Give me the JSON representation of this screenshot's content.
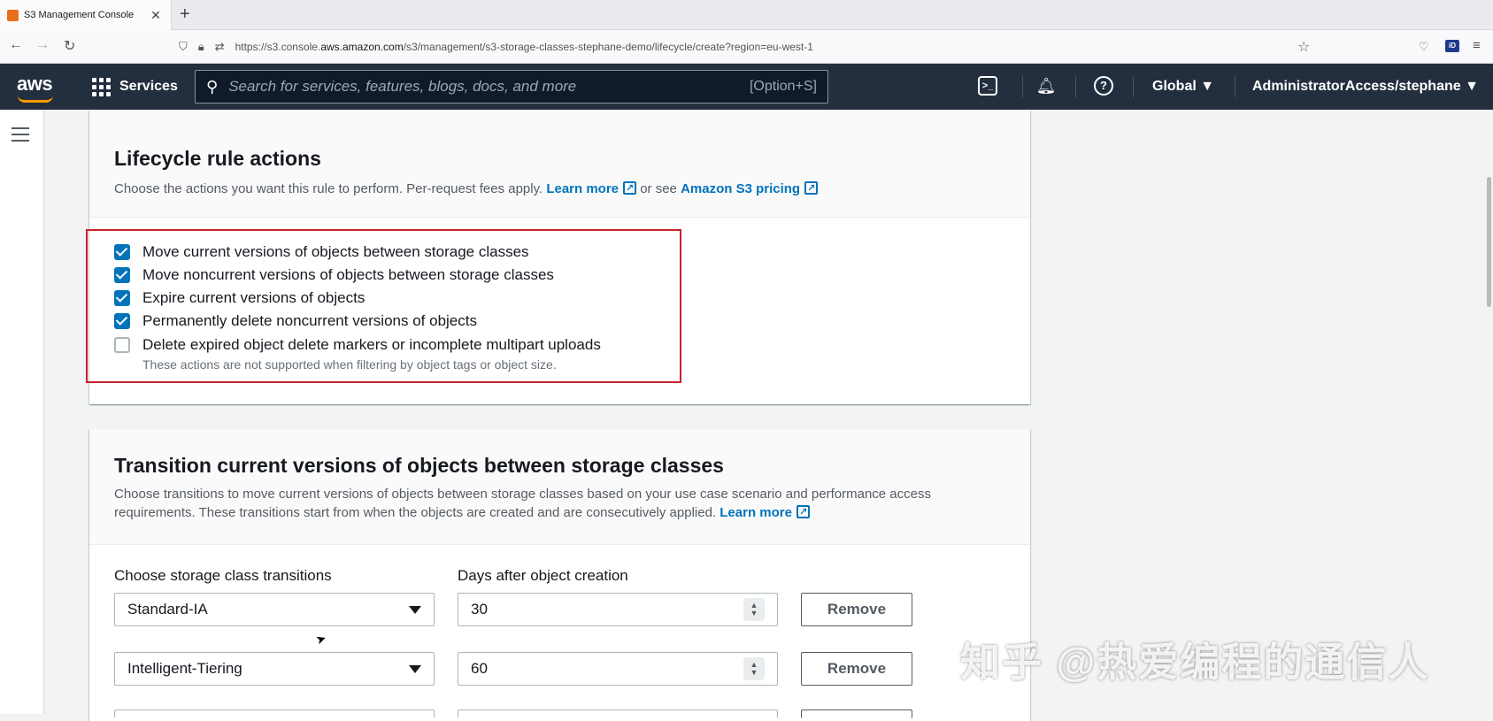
{
  "browser": {
    "tab_title": "S3 Management Console",
    "tab_close": "✕",
    "new_tab": "+",
    "url_prefix": "https://s3.console.",
    "url_host": "aws.amazon.com",
    "url_path": "/s3/management/s3-storage-classes-stephane-demo/lifecycle/create?region=eu-west-1",
    "ext_label": "iD"
  },
  "aws_header": {
    "logo": "aws",
    "services_label": "Services",
    "search_placeholder": "Search for services, features, blogs, docs, and more",
    "search_shortcut": "[Option+S]",
    "region_label": "Global ▼",
    "account_label": "AdministratorAccess/stephane ▼"
  },
  "lifecycle_actions": {
    "title": "Lifecycle rule actions",
    "description": "Choose the actions you want this rule to perform. Per-request fees apply.",
    "learn_more": "Learn more",
    "or_see": "or see",
    "pricing_link": "Amazon S3 pricing",
    "options": [
      {
        "label": "Move current versions of objects between storage classes",
        "checked": true
      },
      {
        "label": "Move noncurrent versions of objects between storage classes",
        "checked": true
      },
      {
        "label": "Expire current versions of objects",
        "checked": true
      },
      {
        "label": "Permanently delete noncurrent versions of objects",
        "checked": true
      },
      {
        "label": "Delete expired object delete markers or incomplete multipart uploads",
        "checked": false
      }
    ],
    "note": "These actions are not supported when filtering by object tags or object size."
  },
  "transitions": {
    "title": "Transition current versions of objects between storage classes",
    "description_line1": "Choose transitions to move current versions of objects between storage classes based on your use case scenario and performance access",
    "description_line2": "requirements. These transitions start from when the objects are created and are consecutively applied.",
    "learn_more": "Learn more",
    "col_storage": "Choose storage class transitions",
    "col_days": "Days after object creation",
    "rows": [
      {
        "storage_class": "Standard-IA",
        "days": "30",
        "remove_label": "Remove"
      },
      {
        "storage_class": "Intelligent-Tiering",
        "days": "60",
        "remove_label": "Remove"
      }
    ]
  },
  "watermark": "知乎 @热爱编程的通信人"
}
